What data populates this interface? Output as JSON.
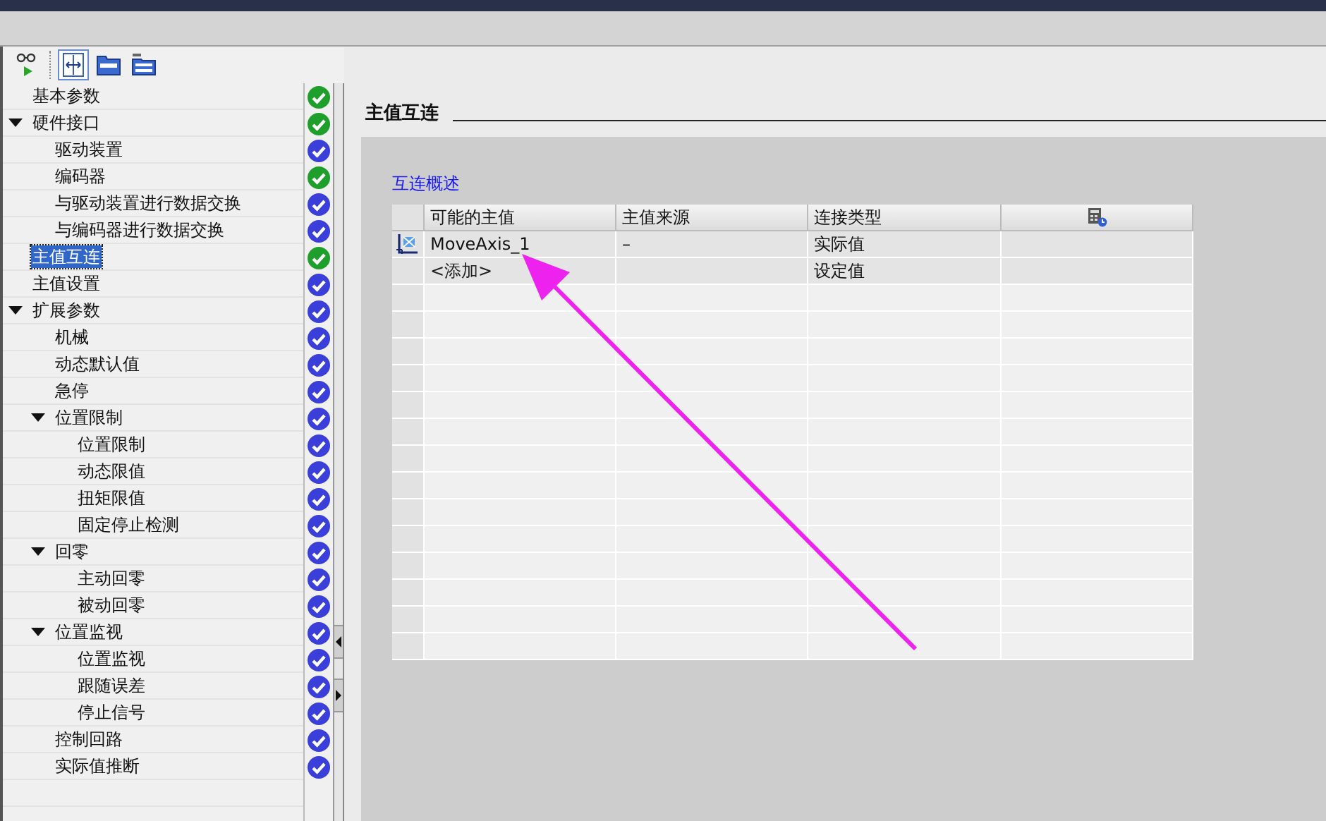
{
  "toolbar": [
    {
      "pressed": false
    },
    {
      "pressed": true
    },
    {
      "pressed": false
    },
    {
      "pressed": false
    }
  ],
  "tree": [
    {
      "label": "基本参数",
      "color": "#1e9e2a",
      "selected": false
    },
    {
      "label": "硬件接口",
      "color": "#1e9e2a",
      "selected": false,
      "expanded": true,
      "children": [
        {
          "label": "驱动装置",
          "color": "#3a3fd9",
          "selected": false
        },
        {
          "label": "编码器",
          "color": "#1e9e2a",
          "selected": false
        },
        {
          "label": "与驱动装置进行数据交换",
          "color": "#3a3fd9",
          "selected": false
        },
        {
          "label": "与编码器进行数据交换",
          "color": "#3a3fd9",
          "selected": false
        }
      ]
    },
    {
      "label": "主值互连",
      "color": "#1e9e2a",
      "selected": true
    },
    {
      "label": "主值设置",
      "color": "#3a3fd9",
      "selected": false
    },
    {
      "label": "扩展参数",
      "color": "#3a3fd9",
      "selected": false,
      "expanded": true,
      "children": [
        {
          "label": "机械",
          "color": "#3a3fd9",
          "selected": false
        },
        {
          "label": "动态默认值",
          "color": "#3a3fd9",
          "selected": false
        },
        {
          "label": "急停",
          "color": "#3a3fd9",
          "selected": false
        },
        {
          "label": "位置限制",
          "color": "#3a3fd9",
          "selected": false,
          "expanded": true,
          "children": [
            {
              "label": "位置限制",
              "color": "#3a3fd9",
              "selected": false
            },
            {
              "label": "动态限值",
              "color": "#3a3fd9",
              "selected": false
            },
            {
              "label": "扭矩限值",
              "color": "#3a3fd9",
              "selected": false
            },
            {
              "label": "固定停止检测",
              "color": "#3a3fd9",
              "selected": false
            }
          ]
        },
        {
          "label": "回零",
          "color": "#3a3fd9",
          "selected": false,
          "expanded": true,
          "children": [
            {
              "label": "主动回零",
              "color": "#3a3fd9",
              "selected": false
            },
            {
              "label": "被动回零",
              "color": "#3a3fd9",
              "selected": false
            }
          ]
        },
        {
          "label": "位置监视",
          "color": "#3a3fd9",
          "selected": false,
          "expanded": true,
          "children": [
            {
              "label": "位置监视",
              "color": "#3a3fd9",
              "selected": false
            },
            {
              "label": "跟随误差",
              "color": "#3a3fd9",
              "selected": false
            },
            {
              "label": "停止信号",
              "color": "#3a3fd9",
              "selected": false
            }
          ]
        },
        {
          "label": "控制回路",
          "color": "#3a3fd9",
          "selected": false
        },
        {
          "label": "实际值推断",
          "color": "#3a3fd9",
          "selected": false
        }
      ]
    }
  ],
  "section_title": "主值互连",
  "overview_link": "互连概述",
  "table": {
    "columns": [
      {
        "kind": "text",
        "label": "可能的主值"
      },
      {
        "kind": "text",
        "label": "主值来源"
      },
      {
        "kind": "text",
        "label": "连接类型"
      },
      {
        "kind": "icon"
      }
    ],
    "rows": [
      {
        "kind": "axis",
        "possible_master": "MoveAxis_1",
        "source": "–",
        "connection_type": "实际值"
      },
      {
        "kind": "add",
        "possible_master": "<添加>",
        "connection_type": "设定值"
      }
    ]
  }
}
